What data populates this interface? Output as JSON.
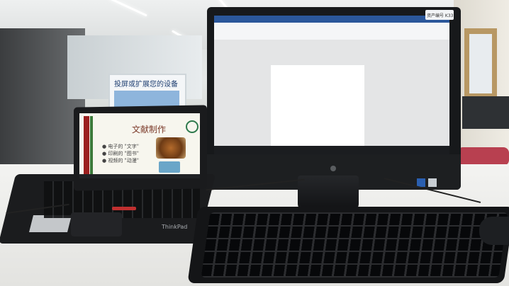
{
  "scene": {
    "description_labels": {
      "sign_text": "投屏或扩展您的设备",
      "laptop_slide_title": "文献制作",
      "laptop_slide_bullets": [
        "● 电子的 \"文字\"",
        "● 印刷的 \"图书\"",
        "● 视频的 \"动漫\""
      ],
      "laptop_brand": "ThinkPad",
      "monitor_sticker": "资产编号 K33"
    }
  }
}
